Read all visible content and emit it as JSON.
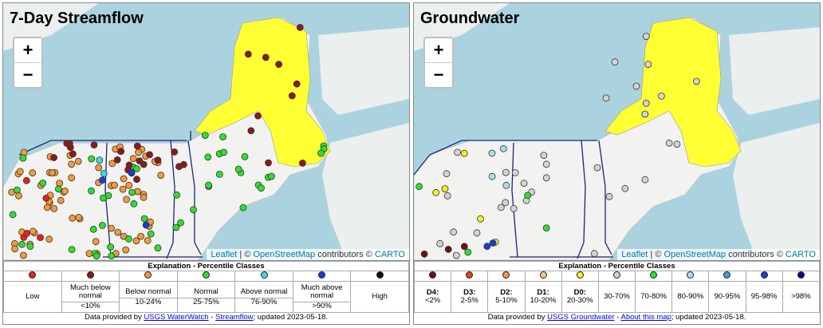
{
  "left": {
    "title": "7-Day Streamflow",
    "zoom_in": "+",
    "zoom_out": "−",
    "attribution": {
      "leaflet": "Leaflet",
      "sep1": " | © ",
      "osm": "OpenStreetMap",
      "mid": " contributors © ",
      "carto": "CARTO"
    },
    "legend_header": "Explanation - Percentile Classes",
    "classes": [
      {
        "color": "#e8201e",
        "label": "Low",
        "range": ""
      },
      {
        "color": "#8b1a1a",
        "label": "Much below normal",
        "range": "<10%"
      },
      {
        "color": "#f39a3a",
        "label": "Below normal",
        "range": "10-24%"
      },
      {
        "color": "#2ee02e",
        "label": "Normal",
        "range": "25-75%"
      },
      {
        "color": "#40d8e0",
        "label": "Above normal",
        "range": "76-90%"
      },
      {
        "color": "#1a3cdc",
        "label": "Much above normal",
        "range": ">90%"
      },
      {
        "color": "#111111",
        "label": "High",
        "range": ""
      }
    ],
    "footer": {
      "prefix": "Data provided by ",
      "link1": "USGS WaterWatch",
      "dash": " - ",
      "link2": "Streamflow",
      "suffix": "; updated 2023-05-18."
    }
  },
  "right": {
    "title": "Groundwater",
    "zoom_in": "+",
    "zoom_out": "−",
    "attribution": {
      "leaflet": "Leaflet",
      "sep1": " | © ",
      "osm": "OpenStreetMap",
      "mid": " contributors © ",
      "carto": "CARTO"
    },
    "legend_header": "Explanation - Percentile Classes",
    "classes": [
      {
        "color": "#6b1212",
        "code": "D4:",
        "range": "<2%"
      },
      {
        "color": "#d94a1a",
        "code": "D3:",
        "range": "2-5%"
      },
      {
        "color": "#f09a3a",
        "code": "D2:",
        "range": "5-10%"
      },
      {
        "color": "#f6c58a",
        "code": "D1:",
        "range": "10-20%"
      },
      {
        "color": "#f2f21c",
        "code": "D0:",
        "range": "20-30%"
      },
      {
        "color": "#d3d3d3",
        "code": "",
        "range": "30-70%"
      },
      {
        "color": "#2ee02e",
        "code": "",
        "range": "70-80%"
      },
      {
        "color": "#a8dff0",
        "code": "",
        "range": "80-90%"
      },
      {
        "color": "#3aa0e0",
        "code": "",
        "range": "90-95%"
      },
      {
        "color": "#1a3cdc",
        "code": "",
        "range": "95-98%"
      },
      {
        "color": "#0a0a90",
        "code": "",
        "range": ">98%"
      }
    ],
    "footer": {
      "prefix": "Data provided by ",
      "link1": "USGS Groundwater",
      "dash": " - ",
      "link2": "About this map",
      "suffix": "; updated 2023-05-18."
    }
  },
  "colors": {
    "drought_fill": "#ffff33",
    "water": "#abd3df",
    "land": "#f2f2f0",
    "border": "#1a237e"
  }
}
